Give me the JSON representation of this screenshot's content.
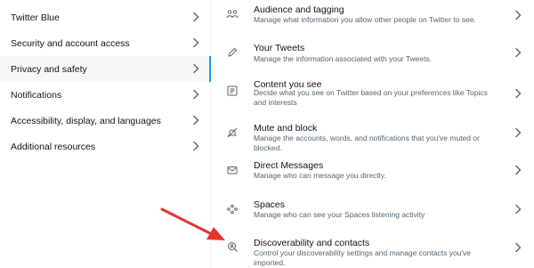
{
  "sidebar": {
    "items": [
      {
        "label": "Twitter Blue"
      },
      {
        "label": "Security and account access"
      },
      {
        "label": "Privacy and safety",
        "active": true
      },
      {
        "label": "Notifications"
      },
      {
        "label": "Accessibility, display, and languages"
      },
      {
        "label": "Additional resources"
      }
    ]
  },
  "settings": {
    "rows": [
      {
        "title": "Audience and tagging",
        "desc": "Manage what information you allow other people on Twitter to see.",
        "icon": "people-icon"
      },
      {
        "title": "Your Tweets",
        "desc": "Manage the information associated with your Tweets.",
        "icon": "pencil-icon"
      },
      {
        "title": "Content you see",
        "desc": "Decide what you see on Twitter based on your preferences like Topics and interests",
        "icon": "content-icon"
      },
      {
        "title": "Mute and block",
        "desc": "Manage the accounts, words, and notifications that you've muted or blocked.",
        "icon": "mute-icon"
      },
      {
        "title": "Direct Messages",
        "desc": "Manage who can message you directly.",
        "icon": "envelope-icon"
      },
      {
        "title": "Spaces",
        "desc": "Manage who can see your Spaces listening activity",
        "icon": "spaces-icon"
      },
      {
        "title": "Discoverability and contacts",
        "desc": "Control your discoverability settings and manage contacts you've imported.",
        "icon": "discover-icon"
      }
    ]
  },
  "colors": {
    "accent": "#1d9bf0",
    "annotation_arrow": "#e8332a",
    "secondary_text": "#536471"
  }
}
